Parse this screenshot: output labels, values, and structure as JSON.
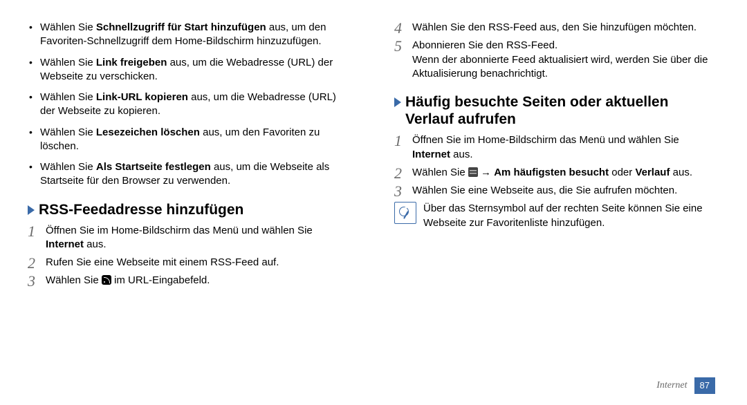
{
  "left": {
    "bullets": [
      {
        "pre": "Wählen Sie ",
        "bold": "Schnellzugriff für Start hinzufügen",
        "post": " aus, um den Favoriten-Schnellzugriff dem Home-Bildschirm hinzuzufügen."
      },
      {
        "pre": "Wählen Sie ",
        "bold": "Link freigeben",
        "post": " aus, um die Webadresse (URL) der Webseite zu verschicken."
      },
      {
        "pre": "Wählen Sie ",
        "bold": "Link-URL kopieren",
        "post": " aus, um die Webadresse (URL) der Webseite zu kopieren."
      },
      {
        "pre": "Wählen Sie ",
        "bold": "Lesezeichen löschen",
        "post": " aus, um den Favoriten zu löschen."
      },
      {
        "pre": "Wählen Sie ",
        "bold": "Als Startseite festlegen",
        "post": " aus, um die Webseite als Startseite für den Browser zu verwenden."
      }
    ],
    "heading": "RSS-Feedadresse hinzufügen",
    "steps": {
      "s1a": "Öffnen Sie im Home-Bildschirm das Menü und wählen Sie ",
      "s1b": "Internet",
      "s1c": " aus.",
      "s2": "Rufen Sie eine Webseite mit einem RSS-Feed auf.",
      "s3a": "Wählen Sie ",
      "s3b": " im URL-Eingabefeld."
    }
  },
  "right": {
    "steps45": {
      "s4": "Wählen Sie den RSS-Feed aus, den Sie hinzufügen möchten.",
      "s5a": "Abonnieren Sie den RSS-Feed.",
      "s5b": "Wenn der abonnierte Feed aktualisiert wird, werden Sie über die Aktualisierung benachrichtigt."
    },
    "heading": "Häufig besuchte Seiten oder aktuellen Verlauf aufrufen",
    "steps": {
      "s1a": "Öffnen Sie im Home-Bildschirm das Menü und wählen Sie ",
      "s1b": "Internet",
      "s1c": " aus.",
      "s2a": "Wählen Sie ",
      "s2b": " → ",
      "s2c": "Am häufigsten besucht",
      "s2d": " oder ",
      "s2e": "Verlauf",
      "s2f": " aus.",
      "s3": "Wählen Sie eine Webseite aus, die Sie aufrufen möchten."
    },
    "note": "Über das Sternsymbol auf der rechten Seite können Sie eine Webseite zur Favoritenliste hinzufügen."
  },
  "footer": {
    "section": "Internet",
    "page": "87"
  }
}
